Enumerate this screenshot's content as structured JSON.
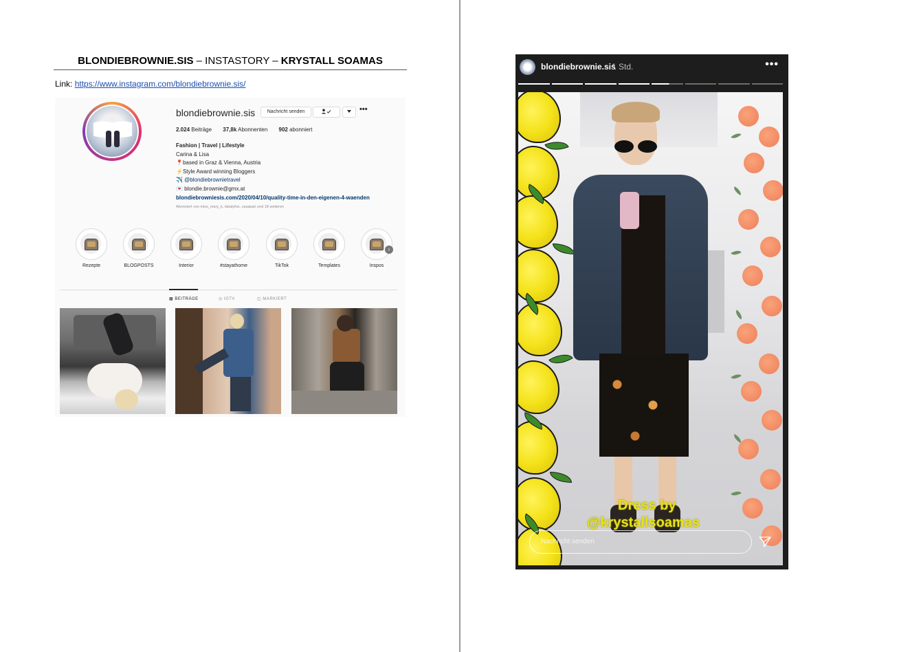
{
  "document": {
    "title_bold_1": "BLONDIEBROWNIE.SIS",
    "title_sep_1": " – INSTASTORY – ",
    "title_bold_2": "KRYSTALL SOAMAS",
    "link_label": "Link: ",
    "link_url": "https://www.instagram.com/blondiebrownie.sis/"
  },
  "profile": {
    "username": "blondiebrownie.sis",
    "message_button": "Nachricht senden",
    "follow_icon": "person-check-icon",
    "dropdown_icon": "caret-down-icon",
    "more_icon": "ellipsis-icon",
    "stats": {
      "posts_value": "2.024",
      "posts_label": "Beiträge",
      "followers_value": "37,8k",
      "followers_label": "Abonnenten",
      "following_value": "902",
      "following_label": "abonniert"
    },
    "bio": {
      "category": "Fashion | Travel | Lifestyle",
      "names": "Carina & Lisa",
      "location": "📍based in Graz & Vienna, Austria",
      "award": "⚡Style Award winning Bloggers",
      "travel": "✈️ @blondiebrownietravel",
      "email": "💌 blondie.brownie@gmx.at",
      "website": "blondiebrowniesis.com/2020/04/10/quality-time-in-den-eigenen-4-waenden"
    },
    "followed_by": "Abonniert von miss_mary_k, lakatyfox, casapari und 18 weiteren",
    "highlights": [
      {
        "label": "Rezepte"
      },
      {
        "label": "BLOGPOSTS"
      },
      {
        "label": "Interior"
      },
      {
        "label": "#stayathome"
      },
      {
        "label": "TikTok"
      },
      {
        "label": "Templates"
      },
      {
        "label": "Inspos"
      }
    ],
    "tabs": [
      {
        "label": "▦ BEITRÄGE",
        "active": true
      },
      {
        "label": "◎ IGTV",
        "active": false
      },
      {
        "label": "◫ MARKIERT",
        "active": false
      }
    ]
  },
  "story": {
    "username": "blondiebrownie.sis",
    "time": "1 Std.",
    "more_icon": "more-horizontal-icon",
    "progress_segments": 8,
    "progress_completed": 4.55,
    "caption_line1": "Dress by",
    "caption_line2": "@krystallsoamas",
    "message_placeholder": "Nachricht senden",
    "send_icon": "paper-plane-icon",
    "colors": {
      "caption": "#e8e21a",
      "background": "#1d1d1d"
    }
  }
}
